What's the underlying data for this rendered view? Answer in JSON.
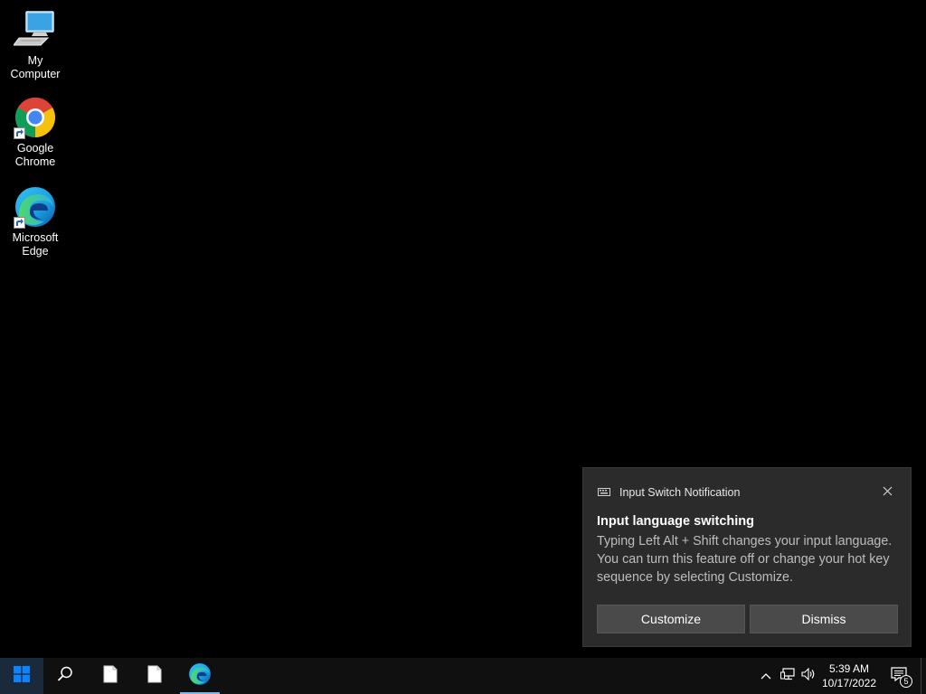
{
  "desktop": {
    "icons": [
      {
        "label": "My Computer"
      },
      {
        "label": "Google Chrome"
      },
      {
        "label": "Microsoft Edge"
      }
    ]
  },
  "notification": {
    "app_name": "Input Switch Notification",
    "title": "Input language switching",
    "body": "Typing Left Alt + Shift changes your input language. You can turn this feature off or change your hot key sequence by selecting Customize.",
    "customize_label": "Customize",
    "dismiss_label": "Dismiss"
  },
  "taskbar": {
    "start_icon": "windows-logo-icon",
    "search_icon": "search-icon",
    "pinned": [
      {
        "icon": "blank-document-icon"
      },
      {
        "icon": "blank-document-icon"
      },
      {
        "icon": "edge-icon",
        "active": true
      }
    ],
    "tray": {
      "chevron_icon": "chevron-up-icon",
      "network_icon": "network-icon",
      "volume_icon": "volume-icon"
    },
    "clock": {
      "time": "5:39 AM",
      "date": "10/17/2022"
    },
    "action_center_badge": "5"
  },
  "colors": {
    "accent": "#0078d7",
    "taskbar": "#101010",
    "toast": "#2b2b2b"
  }
}
